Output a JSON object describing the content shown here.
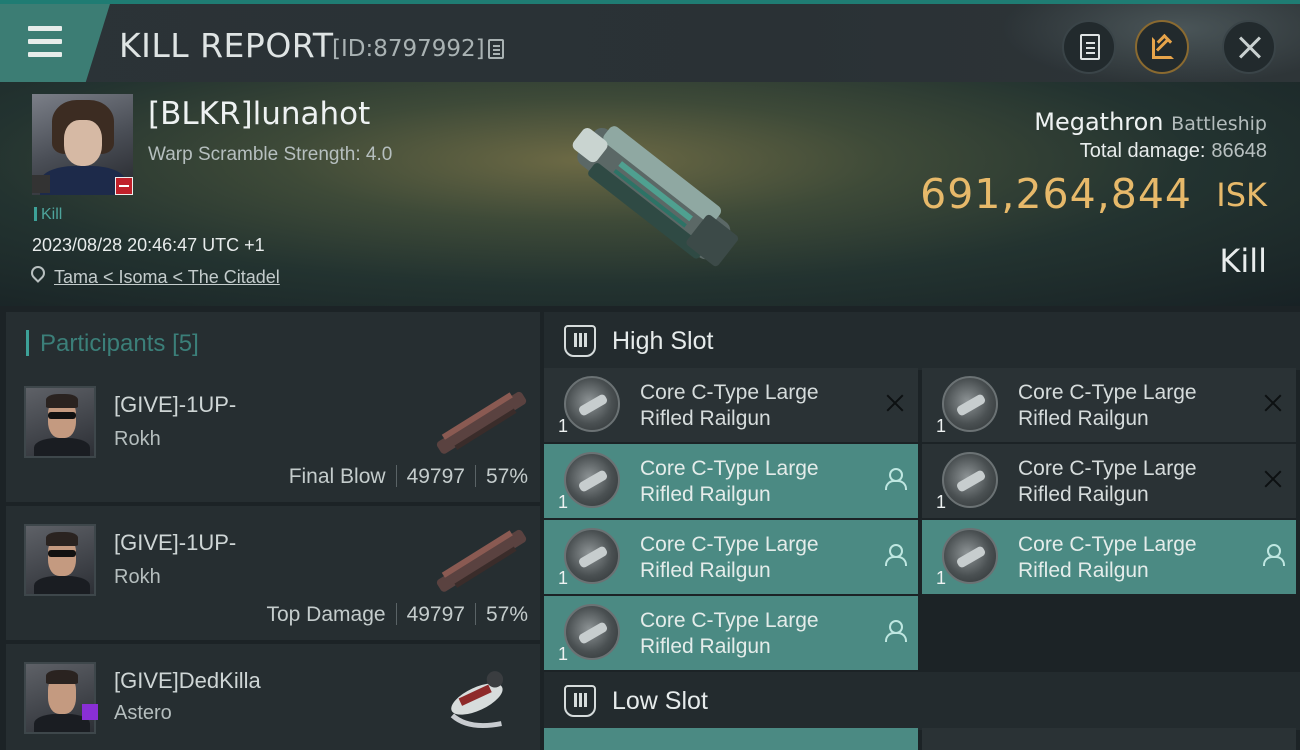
{
  "header": {
    "title": "KILL REPORT",
    "report_id": "[ID:8797992]"
  },
  "victim": {
    "name": "[BLKR]lunahot",
    "warp_scramble": "Warp Scramble Strength: 4.0",
    "tag": "Kill",
    "datetime": "2023/08/28 20:46:47 UTC +1",
    "location": "Tama < Isoma < The Citadel",
    "ship_name": "Megathron",
    "ship_class": "Battleship",
    "total_damage_label": "Total damage:",
    "total_damage": "86648",
    "isk_value": "691,264,844",
    "isk_unit": "ISK",
    "result": "Kill"
  },
  "participants": {
    "label": "Participants",
    "count": "[5]",
    "items": [
      {
        "name": "[GIVE]-1UP-",
        "ship": "Rokh",
        "role": "Final Blow",
        "damage": "49797",
        "percent": "57%"
      },
      {
        "name": "[GIVE]-1UP-",
        "ship": "Rokh",
        "role": "Top Damage",
        "damage": "49797",
        "percent": "57%"
      },
      {
        "name": "[GIVE]DedKilla",
        "ship": "Astero"
      }
    ]
  },
  "high_slot": {
    "title": "High Slot",
    "modules": [
      {
        "name": "Core C-Type Large Rifled Railgun",
        "qty": "1",
        "status": "destroyed"
      },
      {
        "name": "Core C-Type Large Rifled Railgun",
        "qty": "1",
        "status": "destroyed"
      },
      {
        "name": "Core C-Type Large Rifled Railgun",
        "qty": "1",
        "status": "dropped"
      },
      {
        "name": "Core C-Type Large Rifled Railgun",
        "qty": "1",
        "status": "destroyed"
      },
      {
        "name": "Core C-Type Large Rifled Railgun",
        "qty": "1",
        "status": "dropped"
      },
      {
        "name": "Core C-Type Large Rifled Railgun",
        "qty": "1",
        "status": "dropped"
      },
      {
        "name": "Core C-Type Large Rifled Railgun",
        "qty": "1",
        "status": "dropped"
      }
    ]
  },
  "low_slot": {
    "title": "Low Slot"
  },
  "colors": {
    "accent": "#3da198",
    "isk": "#e7b96a",
    "module_dropped_bg": "#4b8a83",
    "module_destroyed_bg": "#2a3235"
  }
}
